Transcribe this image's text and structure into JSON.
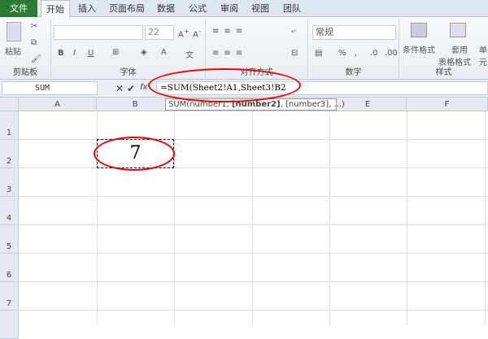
{
  "tabs": [
    "文件",
    "开始",
    "插入",
    "页面布局",
    "数据",
    "公式",
    "审阅",
    "视图",
    "团队"
  ],
  "ribbon": {
    "clipboard": {
      "paste": "粘贴",
      "label": "剪贴板"
    },
    "font": {
      "size": "22",
      "bold": "B",
      "italic": "I",
      "underline": "U",
      "label": "字体"
    },
    "alignment": {
      "label": "对齐方式"
    },
    "number": {
      "format": "常规",
      "percent": "%",
      "comma": ",",
      "label": "数字"
    },
    "styles": {
      "conditional": "条件格式",
      "table_1": "套用",
      "table_2": "表格格式",
      "cell": "单元",
      "label": "样式"
    }
  },
  "formula_bar": {
    "name_box": "SUM",
    "fx": "fx",
    "formula": "=SUM(Sheet2!A1,Sheet3!B2"
  },
  "tooltip": {
    "pre": "SUM(number1, ",
    "bold": "[number2]",
    "post": ", [number3], ...)"
  },
  "columns": [
    "A",
    "B",
    "C",
    "D",
    "E",
    "F"
  ],
  "rows": [
    "1",
    "2",
    "3",
    "4",
    "5",
    "6",
    "7"
  ],
  "cell_b2": "7",
  "colors": {
    "file_tab": "#2d7a34",
    "annotation": "#e00000"
  }
}
